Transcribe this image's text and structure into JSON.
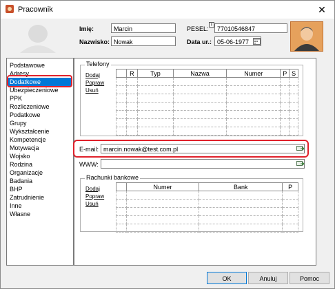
{
  "window": {
    "title": "Pracownik"
  },
  "header": {
    "imie_label": "Imię:",
    "imie_value": "Marcin",
    "nazwisko_label": "Nazwisko:",
    "nazwisko_value": "Nowak",
    "pesel_label": "PESEL:",
    "pesel_value": "77010546847",
    "data_label": "Data ur.:",
    "data_value": "05-06-1977"
  },
  "sidebar": {
    "items": [
      {
        "label": "Podstawowe"
      },
      {
        "label": "Adresy"
      },
      {
        "label": "Dodatkowe"
      },
      {
        "label": "Ubezpieczeniowe"
      },
      {
        "label": "PPK"
      },
      {
        "label": "Rozliczeniowe"
      },
      {
        "label": "Podatkowe"
      },
      {
        "label": "Grupy"
      },
      {
        "label": "Wykształcenie"
      },
      {
        "label": "Kompetencje"
      },
      {
        "label": "Motywacja"
      },
      {
        "label": "Wojsko"
      },
      {
        "label": "Rodzina"
      },
      {
        "label": "Organizacje"
      },
      {
        "label": "Badania"
      },
      {
        "label": "BHP"
      },
      {
        "label": "Zatrudnienie"
      },
      {
        "label": "Inne"
      },
      {
        "label": "Własne"
      }
    ],
    "selected_index": 2
  },
  "telefony": {
    "title": "Telefony",
    "actions": [
      "Dodaj",
      "Popraw",
      "Usuń"
    ],
    "columns": [
      "",
      "R",
      "Typ",
      "Nazwa",
      "Numer",
      "P",
      "S"
    ]
  },
  "email": {
    "label": "E-mail:",
    "value": "marcin.nowak@test.com.pl"
  },
  "www": {
    "label": "WWW:",
    "value": ""
  },
  "rachunki": {
    "title": "Rachunki bankowe",
    "actions": [
      "Dodaj",
      "Popraw",
      "Usuń"
    ],
    "columns": [
      "",
      "Numer",
      "Bank",
      "P"
    ]
  },
  "buttons": {
    "ok": "OK",
    "cancel": "Anuluj",
    "help": "Pomoc"
  },
  "colors": {
    "selection": "#0078d7",
    "highlight_ring": "#e0202a",
    "avatar": "#e6a15c"
  }
}
